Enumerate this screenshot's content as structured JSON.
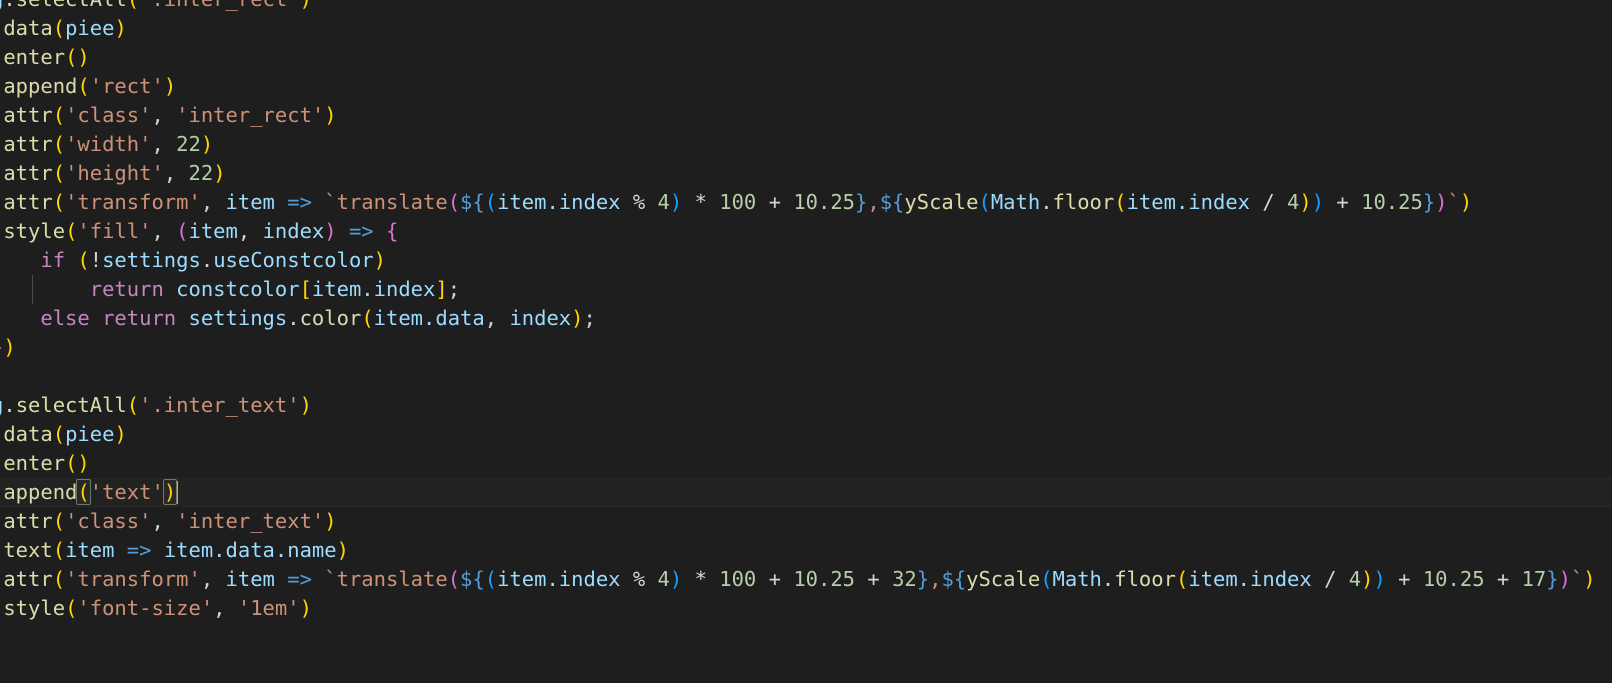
{
  "editor": {
    "name": "code-editor",
    "language": "javascript",
    "theme": "Dark+ (default dark)",
    "background_color": "#1e1e1e",
    "active_line_background": "#222222",
    "caret_color": "#aeafad",
    "bracket_match_border_color": "#6b7a62",
    "horizontally_scrolled": true,
    "cursor_line_number": 15,
    "cursor_column_text": "append('text')"
  },
  "colors": {
    "plain": "#d4d4d4",
    "function": "#dcdcaa",
    "variable": "#9cdcfe",
    "string": "#ce9178",
    "number": "#b5cea8",
    "keyword": "#c586c0",
    "arrow": "#569cd6",
    "bracket_level_0": "#ffd700",
    "bracket_level_1": "#da70d6",
    "bracket_level_2": "#179fff",
    "indent_guide": "#4a4a4a"
  },
  "code_lines": [
    {
      "id": 1,
      "active": false,
      "text": "g.selectAll('.inter_rect')"
    },
    {
      "id": 2,
      "active": false,
      "text": ".data(piee)"
    },
    {
      "id": 3,
      "active": false,
      "text": ".enter()"
    },
    {
      "id": 4,
      "active": false,
      "text": ".append('rect')"
    },
    {
      "id": 5,
      "active": false,
      "text": ".attr('class', 'inter_rect')"
    },
    {
      "id": 6,
      "active": false,
      "text": ".attr('width', 22)"
    },
    {
      "id": 7,
      "active": false,
      "text": ".attr('height', 22)"
    },
    {
      "id": 8,
      "active": false,
      "text": ".attr('transform', item => `translate(${(item.index % 4) * 100 + 10.25},${yScale(Math.floor(item.index / 4)) + 10.25})`)"
    },
    {
      "id": 9,
      "active": false,
      "text": ".style('fill', (item, index) => {"
    },
    {
      "id": 10,
      "active": false,
      "text": "    if (!settings.useConstcolor)"
    },
    {
      "id": 11,
      "active": false,
      "text": "        return constcolor[item.index];"
    },
    {
      "id": 12,
      "active": false,
      "text": "    else return settings.color(item.data, index);"
    },
    {
      "id": 13,
      "active": false,
      "text": "})"
    },
    {
      "id": 14,
      "active": false,
      "text": ""
    },
    {
      "id": 15,
      "active": false,
      "text": "g.selectAll('.inter_text')"
    },
    {
      "id": 16,
      "active": false,
      "text": ".data(piee)"
    },
    {
      "id": 17,
      "active": false,
      "text": ".enter()"
    },
    {
      "id": 18,
      "active": true,
      "text": ".append('text')"
    },
    {
      "id": 19,
      "active": false,
      "text": ".attr('class', 'inter_text')"
    },
    {
      "id": 20,
      "active": false,
      "text": ".text(item => item.data.name)"
    },
    {
      "id": 21,
      "active": false,
      "text": ".attr('transform', item => `translate(${(item.index % 4) * 100 + 10.25 + 32},${yScale(Math.floor(item.index / 4)) + 10.25 + 17})`)"
    },
    {
      "id": 22,
      "active": false,
      "text": ".style('font-size', '1em')"
    }
  ]
}
